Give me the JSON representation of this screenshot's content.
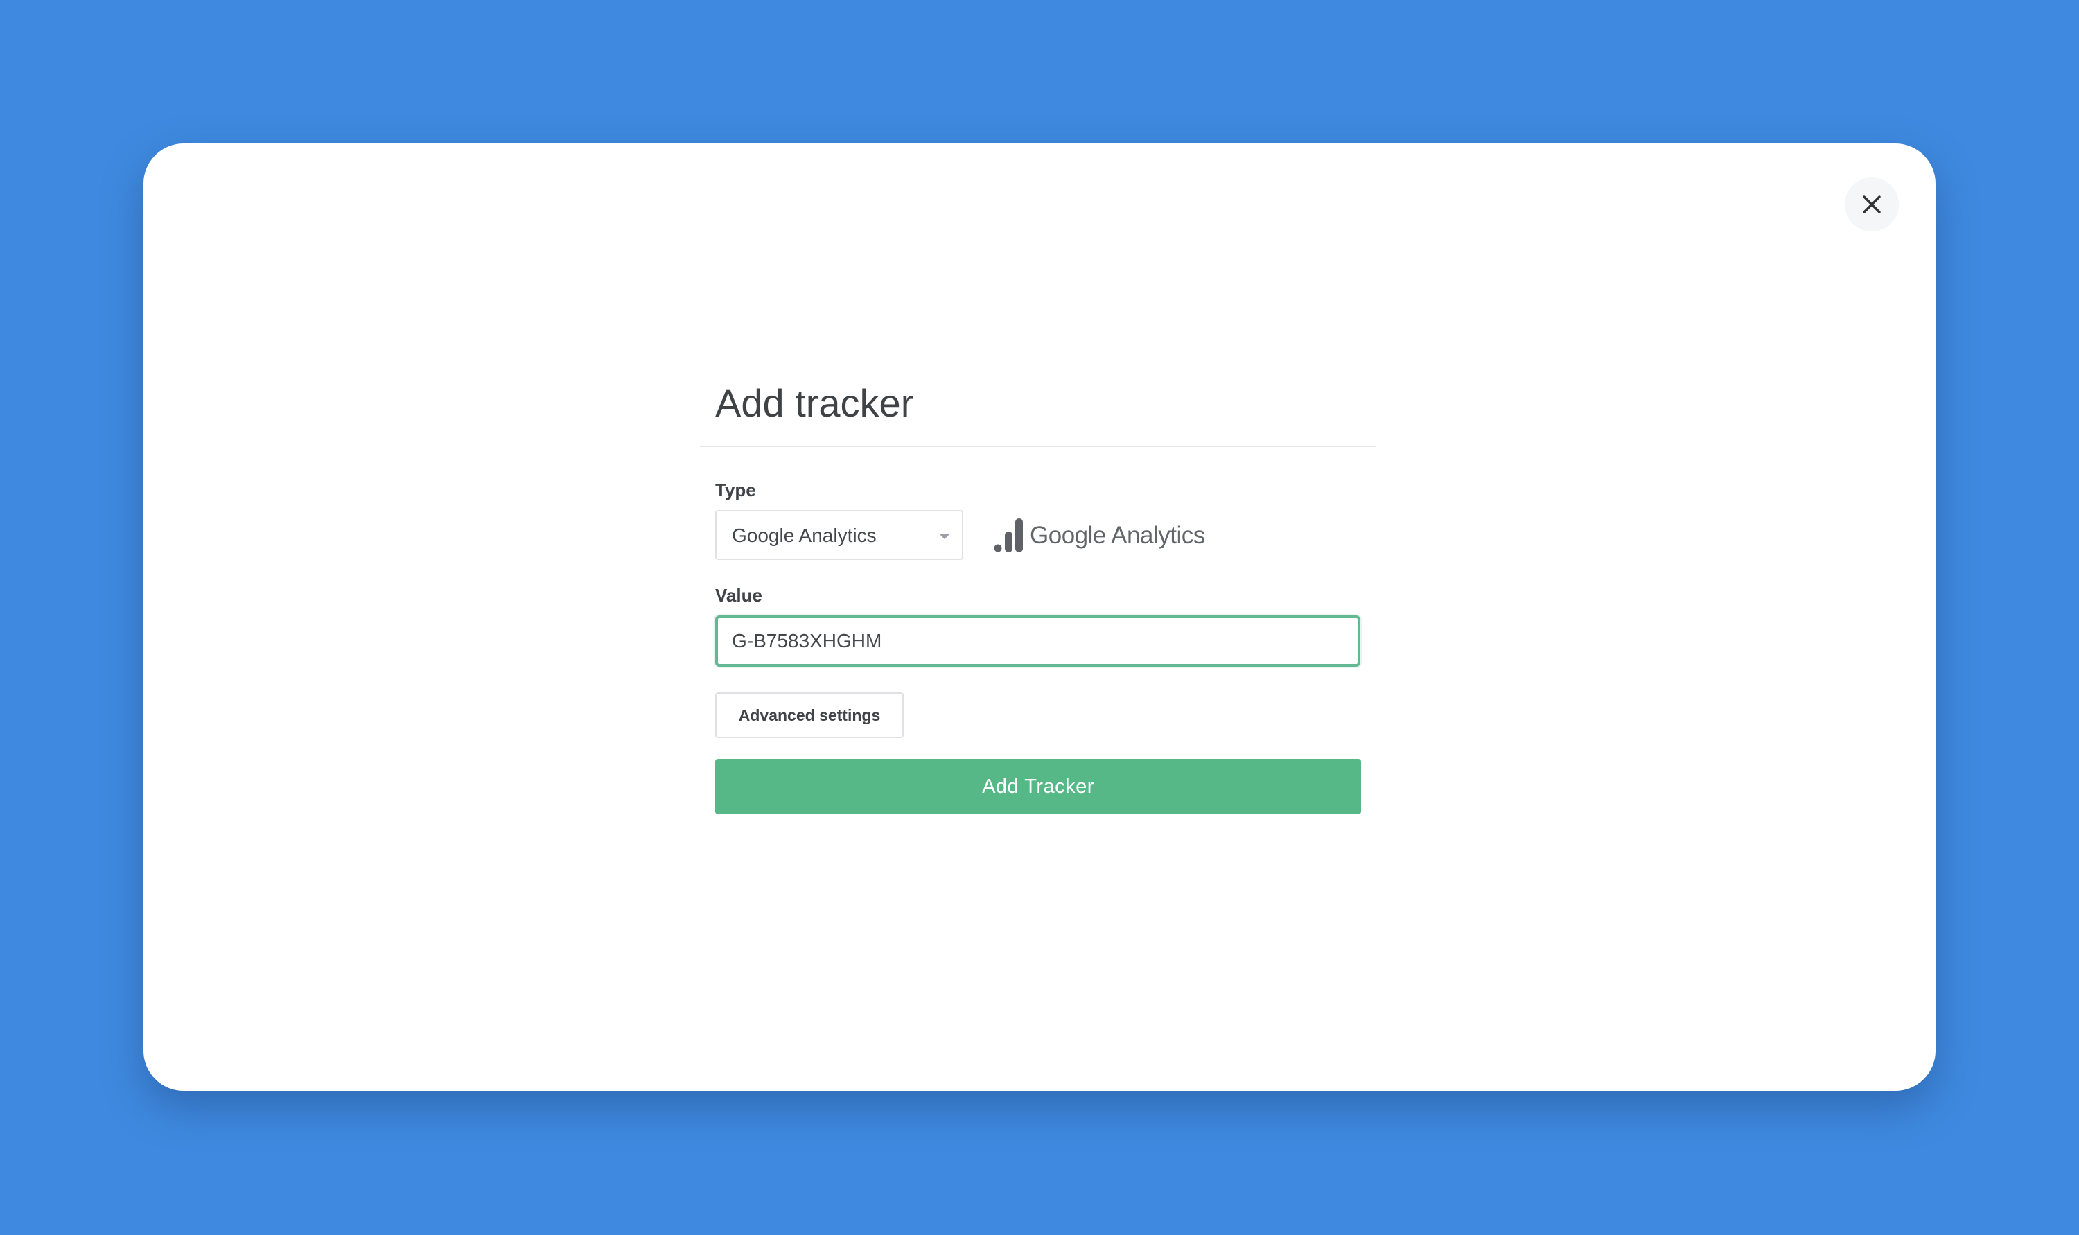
{
  "dialog": {
    "title": "Add tracker",
    "close_icon": "close-icon"
  },
  "form": {
    "type_label": "Type",
    "type_selected": "Google Analytics",
    "value_label": "Value",
    "value": "G-B7583XHGHM",
    "advanced_settings_label": "Advanced settings",
    "submit_label": "Add Tracker"
  },
  "logo": {
    "icon": "google-analytics-bars-icon",
    "brand": "Google",
    "product": "Analytics"
  },
  "colors": {
    "background": "#3f8ae0",
    "accent": "#55b886",
    "focus_border": "#64b994"
  }
}
